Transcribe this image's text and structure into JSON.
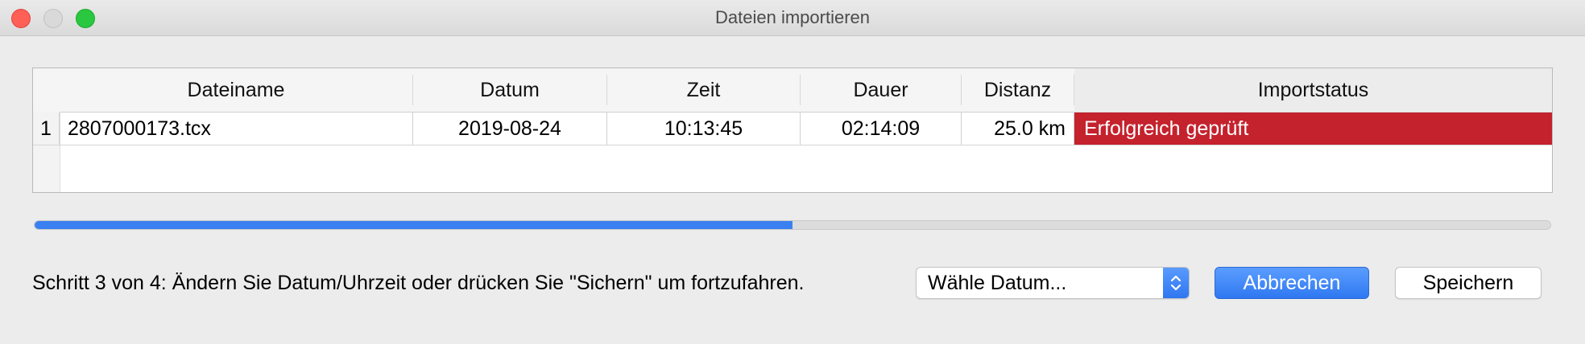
{
  "window": {
    "title": "Dateien importieren"
  },
  "table": {
    "headers": [
      "Dateiname",
      "Datum",
      "Zeit",
      "Dauer",
      "Distanz",
      "Importstatus"
    ],
    "rows": [
      {
        "index": "1",
        "filename": "2807000173.tcx",
        "date": "2019-08-24",
        "time": "10:13:45",
        "duration": "02:14:09",
        "distance": "25.0 km",
        "status": "Erfolgreich geprüft"
      }
    ],
    "status_color": "#c4222d"
  },
  "progress": {
    "value_percent": 50
  },
  "footer": {
    "step_text": "Schritt 3 von 4: Ändern Sie Datum/Uhrzeit oder drücken Sie \"Sichern\"  um fortzufahren.",
    "date_select": {
      "selected": "Wähle Datum..."
    },
    "cancel_label": "Abbrechen",
    "save_label": "Speichern"
  },
  "colors": {
    "accent": "#3b80f0"
  }
}
